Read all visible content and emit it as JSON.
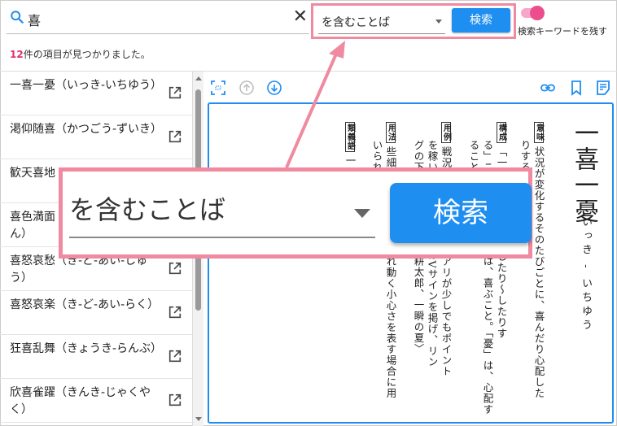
{
  "search": {
    "query": "喜",
    "clear_symbol": "✕"
  },
  "filter": {
    "mode": "を含むことば",
    "search_label": "検索"
  },
  "toggle": {
    "label": "検索キーワードを残す",
    "on": true
  },
  "results": {
    "count": "12",
    "suffix": "件の項目が見つかりました。"
  },
  "list": [
    {
      "text": "一喜一憂（いっき-いちゆう）"
    },
    {
      "text": "渇仰随喜（かつごう-ずいき）"
    },
    {
      "text": "歓天喜地"
    },
    {
      "text": "喜色満面（きしょく-まんめん）"
    },
    {
      "text": "喜怒哀愁（き-ど-あい-しゅう）"
    },
    {
      "text": "喜怒哀楽（き-ど-あい-らく）"
    },
    {
      "text": "狂喜乱舞（きょうき-らんぶ）"
    },
    {
      "text": "欣喜雀躍（きんき-じゃくやく）"
    }
  ],
  "entry": {
    "headword": "一喜一憂",
    "reading": "いっき - いちゆう",
    "tag_meaning": "意味",
    "meaning_1": "状況が変化するそのたびごとに、喜んだり心配した",
    "meaning_2": "りすること。",
    "tag_structure": "構成",
    "structure_1": "「一〜一〜」は、「〜したり〜したりす",
    "structure_2": "る」ことを表す。「喜」は、喜ぶこと。「憂」は、心配す",
    "structure_3": "ること。",
    "tag_example": "用例",
    "example_1": "戦況に一喜一憂した。アリが少しでもポイント",
    "example_2": "を稼いだときには、ニはVサインを掲げ、リン",
    "example_3": "グの下で跳ねた。〈沢木耕太郎、一瞬の夏〉",
    "tag_usage": "用法",
    "usage_1": "些細な状況の変化に揺れ動く小心さを表す場合に用",
    "usage_2": "いられる",
    "tag_synonym": "類義語",
    "synonym_1": "一"
  },
  "zoom": {
    "mode": "を含むことば",
    "search_label": "検索"
  },
  "colors": {
    "accent": "#1e8ef0",
    "highlight": "#ef8aa0",
    "count": "#e0306a",
    "toggle": "#ec4d8c"
  }
}
